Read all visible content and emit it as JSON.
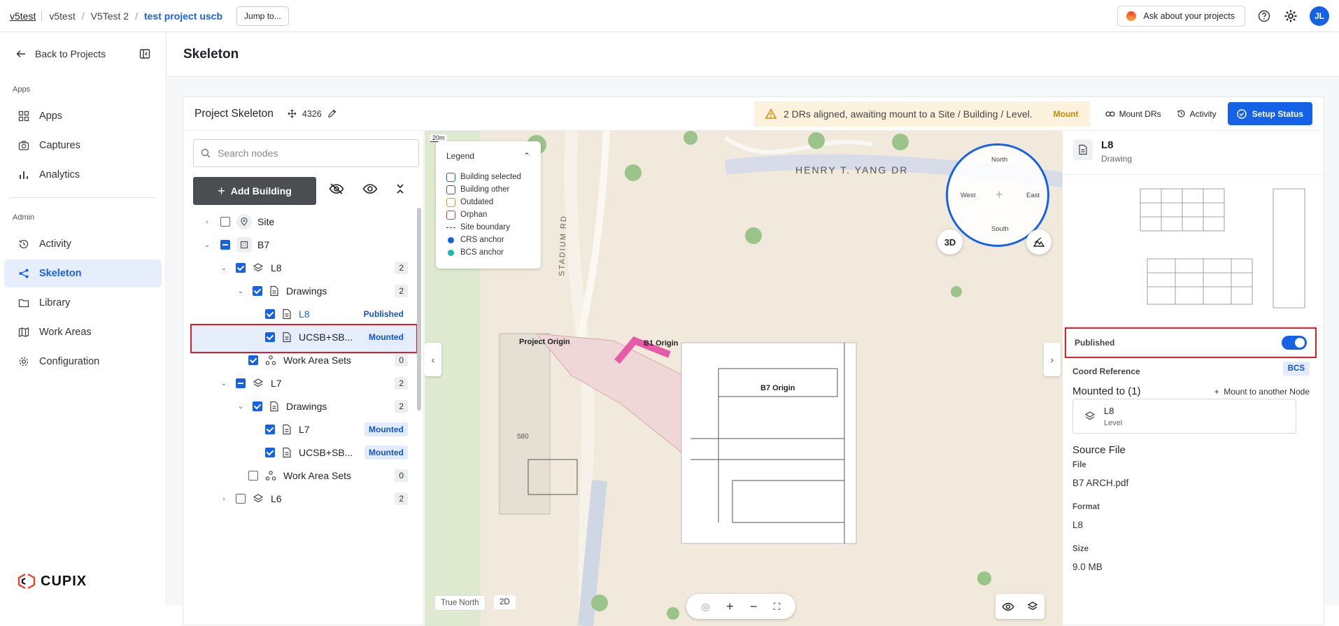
{
  "topbar": {
    "org": "v5test",
    "crumbs": [
      "v5test",
      "V5Test 2",
      "test project uscb"
    ],
    "jump_label": "Jump to...",
    "ask_label": "Ask about your projects",
    "avatar_initials": "JL"
  },
  "sidebar": {
    "back_label": "Back to Projects",
    "apps_section": "Apps",
    "admin_section": "Admin",
    "apps_items": [
      {
        "label": "Apps",
        "icon": "grid-icon"
      },
      {
        "label": "Captures",
        "icon": "camera-icon"
      },
      {
        "label": "Analytics",
        "icon": "bar-chart-icon"
      }
    ],
    "admin_items": [
      {
        "label": "Activity",
        "icon": "history-icon"
      },
      {
        "label": "Skeleton",
        "icon": "share-nodes-icon",
        "active": true
      },
      {
        "label": "Library",
        "icon": "folder-icon"
      },
      {
        "label": "Work Areas",
        "icon": "map-icon"
      },
      {
        "label": "Configuration",
        "icon": "gear-icon"
      }
    ],
    "logo_text": "CUPIX"
  },
  "page": {
    "title": "Skeleton"
  },
  "card": {
    "title": "Project Skeleton",
    "node_id": "4326",
    "warning_text": "2 DRs aligned, awaiting mount to a Site / Building / Level.",
    "warning_action": "Mount",
    "mount_drs": "Mount DRs",
    "activity": "Activity",
    "setup_status": "Setup Status"
  },
  "tree": {
    "search_placeholder": "Search nodes",
    "add_building": "Add Building",
    "rows": [
      {
        "label": "Site",
        "type": "site"
      },
      {
        "label": "B7",
        "type": "building"
      },
      {
        "label": "L8",
        "type": "level",
        "count": "2"
      },
      {
        "label": "Drawings",
        "type": "drawings",
        "count": "2"
      },
      {
        "label": "L8",
        "type": "drawing",
        "status": "Published",
        "selected": true
      },
      {
        "label": "UCSB+SB...",
        "type": "drawing",
        "status": "Mounted"
      },
      {
        "label": "Work Area Sets",
        "type": "workarea",
        "count": "0"
      },
      {
        "label": "L7",
        "type": "level",
        "count": "2"
      },
      {
        "label": "Drawings",
        "type": "drawings",
        "count": "2"
      },
      {
        "label": "L7",
        "type": "drawing",
        "status": "Mounted"
      },
      {
        "label": "UCSB+SB...",
        "type": "drawing",
        "status": "Mounted"
      },
      {
        "label": "Work Area Sets",
        "type": "workarea",
        "count": "0"
      },
      {
        "label": "L6",
        "type": "level",
        "count": "2"
      }
    ]
  },
  "map": {
    "scale": "20m",
    "street_1": "HENRY T. YANG DR",
    "street_2": "STADIUM RD",
    "legend_title": "Legend",
    "legend_items": [
      {
        "label": "Building selected",
        "color": "#1662e6",
        "kind": "box"
      },
      {
        "label": "Building other",
        "color": "#555555",
        "kind": "box"
      },
      {
        "label": "Outdated",
        "color": "#e0a100",
        "kind": "box"
      },
      {
        "label": "Orphan",
        "color": "#e0344b",
        "kind": "box"
      },
      {
        "label": "Site boundary",
        "color": "#333333",
        "kind": "dash"
      },
      {
        "label": "CRS anchor",
        "color": "#1662e6",
        "kind": "dot"
      },
      {
        "label": "BCS anchor",
        "color": "#1fb5b0",
        "kind": "dot"
      }
    ],
    "compass": {
      "north": "North",
      "south": "South",
      "east": "East",
      "west": "West"
    },
    "btn_3d": "3D",
    "labels": {
      "project_origin": "Project Origin",
      "b1_origin": "B1 Origin",
      "b7_origin": "B7 Origin",
      "building_number": "580"
    },
    "true_north": "True North",
    "btn_2d": "2D"
  },
  "detail": {
    "title": "L8",
    "subtitle": "Drawing",
    "published_label": "Published",
    "coord_label": "Coord Reference",
    "coord_value": "BCS",
    "mounted_title": "Mounted to (1)",
    "mount_link": "Mount to another Node",
    "mounted_name": "L8",
    "mounted_type": "Level",
    "source_title": "Source File",
    "file_label": "File",
    "file_value": "B7 ARCH.pdf",
    "format_label": "Format",
    "format_value": "L8",
    "size_label": "Size",
    "size_value": "9.0 MB"
  }
}
